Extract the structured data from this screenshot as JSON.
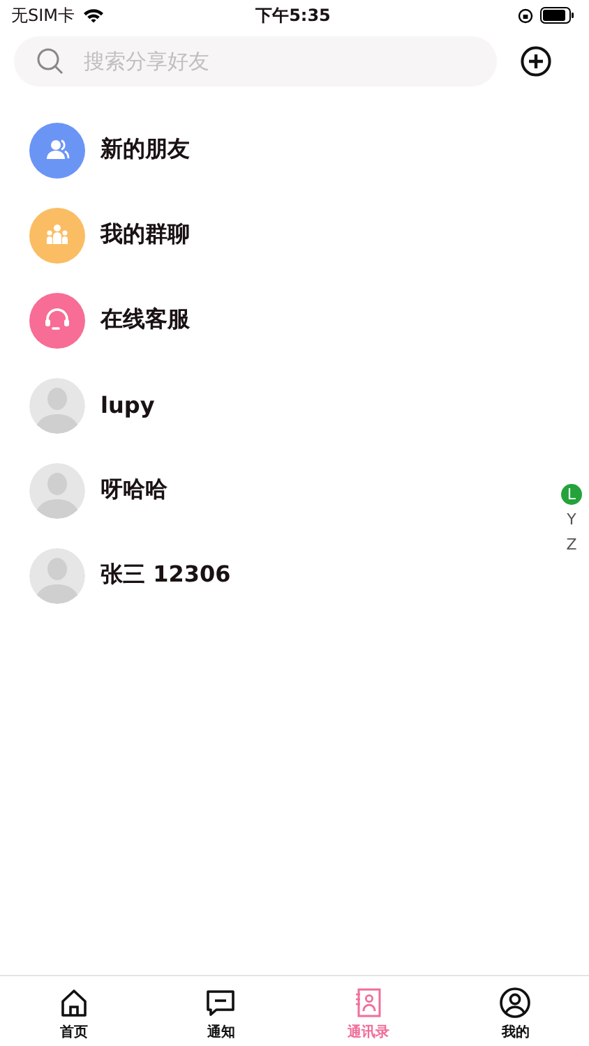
{
  "status_bar": {
    "carrier": "无SIM卡",
    "time": "下午5:35"
  },
  "search": {
    "placeholder": "搜索分享好友"
  },
  "entries": [
    {
      "kind": "function",
      "color": "#6b95f5",
      "name": "新的朋友"
    },
    {
      "kind": "function",
      "color": "#fbbd63",
      "name": "我的群聊"
    },
    {
      "kind": "function",
      "color": "#f76d95",
      "name": "在线客服"
    },
    {
      "kind": "contact",
      "name": "lupy"
    },
    {
      "kind": "contact",
      "name": "呀哈哈"
    },
    {
      "kind": "contact",
      "name": "张三 12306"
    }
  ],
  "index": [
    {
      "letter": "L",
      "selected": true
    },
    {
      "letter": "Y",
      "selected": false
    },
    {
      "letter": "Z",
      "selected": false
    }
  ],
  "tabs": [
    {
      "label": "首页",
      "selected": false
    },
    {
      "label": "通知",
      "selected": false
    },
    {
      "label": "通讯录",
      "selected": true
    },
    {
      "label": "我的",
      "selected": false
    }
  ]
}
